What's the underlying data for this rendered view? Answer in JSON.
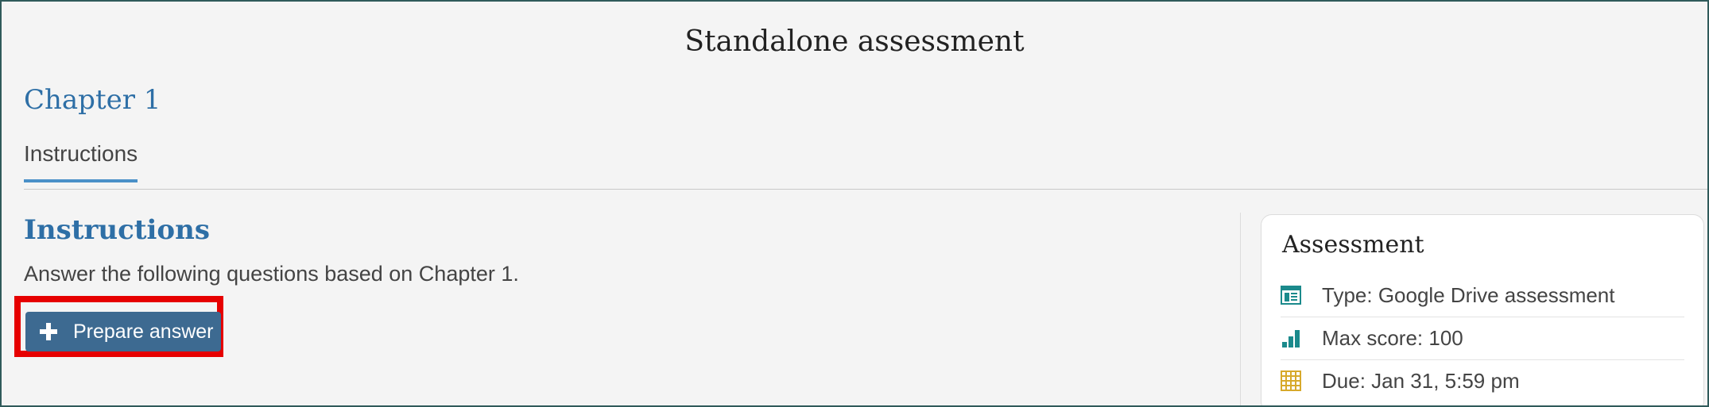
{
  "page": {
    "title": "Standalone assessment"
  },
  "chapter": {
    "title": "Chapter 1"
  },
  "tabs": [
    {
      "label": "Instructions",
      "active": true
    }
  ],
  "main": {
    "heading": "Instructions",
    "text": "Answer the following questions based on Chapter 1.",
    "prepare_button_label": "Prepare answer"
  },
  "assessment_panel": {
    "title": "Assessment",
    "rows": [
      {
        "icon": "document-icon",
        "text": "Type: Google Drive assessment"
      },
      {
        "icon": "bar-chart-icon",
        "text": "Max score: 100"
      },
      {
        "icon": "calendar-icon",
        "text": "Due: Jan 31, 5:59 pm"
      }
    ]
  },
  "colors": {
    "accent_blue": "#2e6fa6",
    "button": "#3d6a91",
    "highlight": "#e60000",
    "icon_teal": "#1b8a8c",
    "icon_gold": "#d7a92b"
  }
}
